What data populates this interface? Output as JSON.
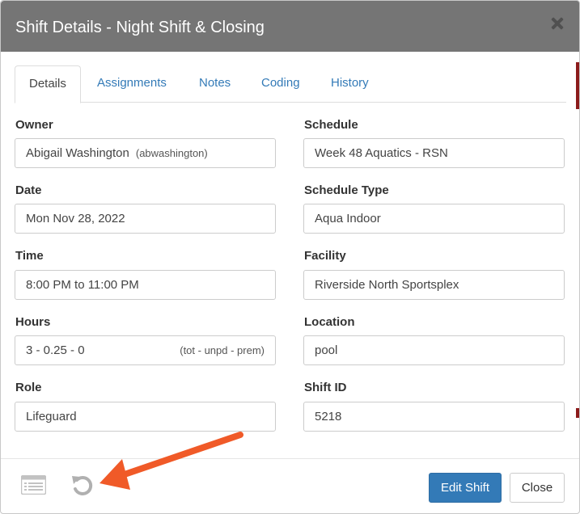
{
  "dialog": {
    "title": "Shift Details - Night Shift & Closing",
    "close_icon": "close-icon"
  },
  "tabs": [
    {
      "label": "Details",
      "active": true
    },
    {
      "label": "Assignments",
      "active": false
    },
    {
      "label": "Notes",
      "active": false
    },
    {
      "label": "Coding",
      "active": false
    },
    {
      "label": "History",
      "active": false
    }
  ],
  "fields": {
    "owner": {
      "label": "Owner",
      "value": "Abigail Washington",
      "username": "(abwashington)"
    },
    "schedule": {
      "label": "Schedule",
      "value": "Week 48 Aquatics - RSN"
    },
    "date": {
      "label": "Date",
      "value": "Mon Nov 28, 2022"
    },
    "schedule_type": {
      "label": "Schedule Type",
      "value": "Aqua Indoor"
    },
    "time": {
      "label": "Time",
      "value": "8:00 PM to 11:00 PM"
    },
    "facility": {
      "label": "Facility",
      "value": "Riverside North Sportsplex"
    },
    "hours": {
      "label": "Hours",
      "value": "3 - 0.25 - 0",
      "hint": "(tot - unpd - prem)"
    },
    "location": {
      "label": "Location",
      "value": "pool"
    },
    "role": {
      "label": "Role",
      "value": "Lifeguard"
    },
    "shift_id": {
      "label": "Shift ID",
      "value": "5218"
    }
  },
  "footer": {
    "icons": [
      "list-icon",
      "undo-icon"
    ],
    "edit_label": "Edit Shift",
    "close_label": "Close"
  },
  "colors": {
    "header": "#757575",
    "primary": "#337ab7",
    "link": "#337ab7",
    "annotation_arrow": "#f05a28"
  }
}
